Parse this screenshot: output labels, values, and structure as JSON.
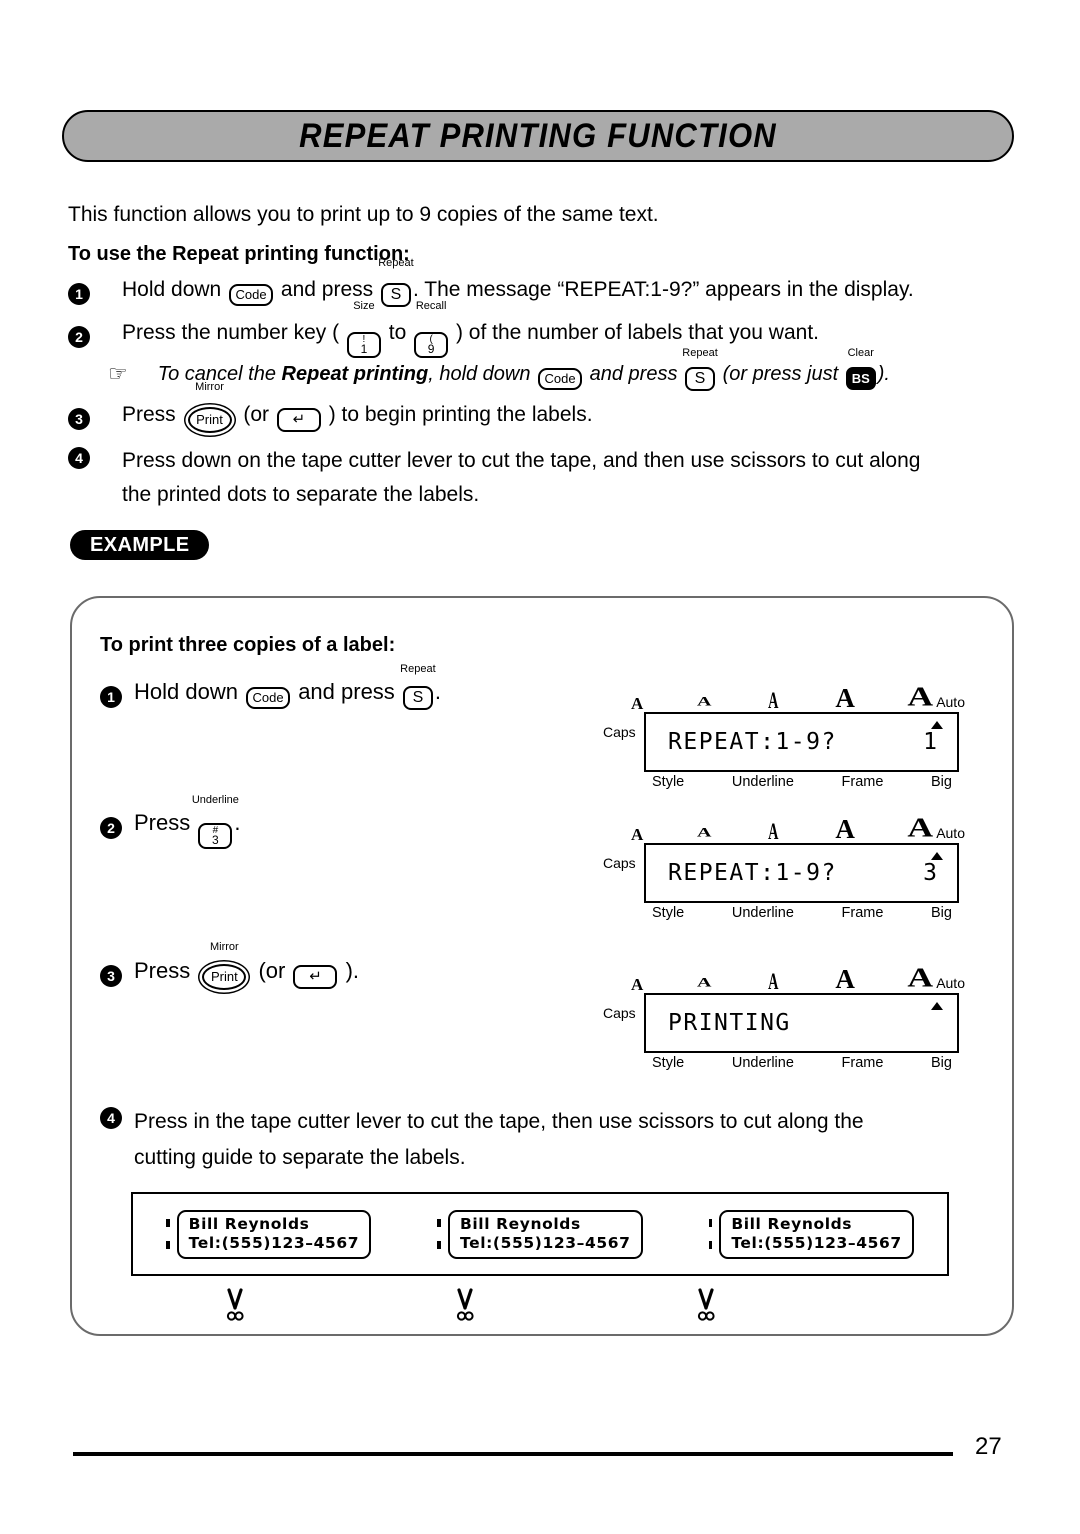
{
  "page": {
    "title": "REPEAT PRINTING FUNCTION",
    "page_number": "27"
  },
  "intro": "This function allows you to print up to 9 copies of the same text.",
  "subhead": "To use the Repeat printing function:",
  "steps": [
    {
      "num": "1",
      "t1": "Hold down ",
      "key1": {
        "label": "Code",
        "cap": ""
      },
      "t2": " and press ",
      "key2": {
        "label": "S",
        "cap": "Repeat"
      },
      "t3": ". The message “REPEAT:1-9?” appears in the display."
    },
    {
      "num": "2",
      "t1": "Press the number key ( ",
      "key1": {
        "top": "!",
        "bot": "1",
        "cap": "Size"
      },
      "t2": " to ",
      "key2": {
        "top": "(",
        "bot": "9",
        "cap": "Recall"
      },
      "t3": " ) of the number of labels that you want."
    },
    {
      "num": "3",
      "t1": "Press ",
      "key1": {
        "label": "Print",
        "cap": "Mirror"
      },
      "t2": " (or ",
      "key2": {
        "label": "↵",
        "cap": ""
      },
      "t3": " ) to begin printing the labels."
    },
    {
      "num": "4",
      "line1": "Press down on the tape cutter lever to cut the tape, and then use scissors to cut along",
      "line2": "the printed dots to separate the labels."
    }
  ],
  "hint": {
    "icon": "☞",
    "t1": "To cancel the ",
    "bold": "Repeat printing",
    "t2": ", hold down ",
    "key1": {
      "label": "Code",
      "cap": ""
    },
    "t3": " and press ",
    "key2": {
      "label": "S",
      "cap": "Repeat"
    },
    "t4": " (or press just ",
    "key3": {
      "label": "BS",
      "cap": "Clear"
    },
    "t5": ")."
  },
  "example": {
    "badge": "EXAMPLE",
    "heading": "To print three copies of a label:",
    "steps": [
      {
        "num": "1",
        "t1": "Hold down ",
        "key1": {
          "label": "Code",
          "cap": ""
        },
        "t2": " and press ",
        "key2": {
          "label": "S",
          "cap": "Repeat"
        },
        "t3": "."
      },
      {
        "num": "2",
        "t1": "Press ",
        "key1": {
          "top": "#",
          "bot": "3",
          "cap": "Underline"
        },
        "t2": "."
      },
      {
        "num": "3",
        "t1": "Press ",
        "key1": {
          "label": "Print",
          "cap": "Mirror"
        },
        "t2": " (or ",
        "key2": {
          "label": "↵",
          "cap": ""
        },
        "t3": " )."
      }
    ],
    "step4": {
      "num": "4",
      "line1": "Press in the tape cutter lever to cut the tape, then use scissors to cut along the",
      "line2": "cutting guide to separate the labels."
    },
    "displays": [
      {
        "caps": "Caps",
        "auto": "Auto",
        "text": "REPEAT:1-9?",
        "count": "1",
        "show_arrow": true,
        "labels": [
          "Style",
          "Underline",
          "Frame",
          "Big"
        ],
        "icons": [
          "A",
          "A",
          "A",
          "A",
          "A"
        ]
      },
      {
        "caps": "Caps",
        "auto": "Auto",
        "text": "REPEAT:1-9?",
        "count": "3",
        "show_arrow": true,
        "labels": [
          "Style",
          "Underline",
          "Frame",
          "Big"
        ],
        "icons": [
          "A",
          "A",
          "A",
          "A",
          "A"
        ]
      },
      {
        "caps": "Caps",
        "auto": "Auto",
        "text": "PRINTING",
        "count": "",
        "show_arrow": true,
        "labels": [
          "Style",
          "Underline",
          "Frame",
          "Big"
        ],
        "icons": [
          "A",
          "A",
          "A",
          "A",
          "A"
        ]
      }
    ],
    "tape_labels": [
      {
        "line1": "Bill Reynolds",
        "line2": "Tel:(555)123–4567"
      },
      {
        "line1": "Bill Reynolds",
        "line2": "Tel:(555)123–4567"
      },
      {
        "line1": "Bill Reynolds",
        "line2": "Tel:(555)123–4567"
      }
    ]
  },
  "colors": {
    "banner_fill": "#aaaaaa",
    "example_border": "#6b6b6b",
    "ink": "#000000"
  }
}
